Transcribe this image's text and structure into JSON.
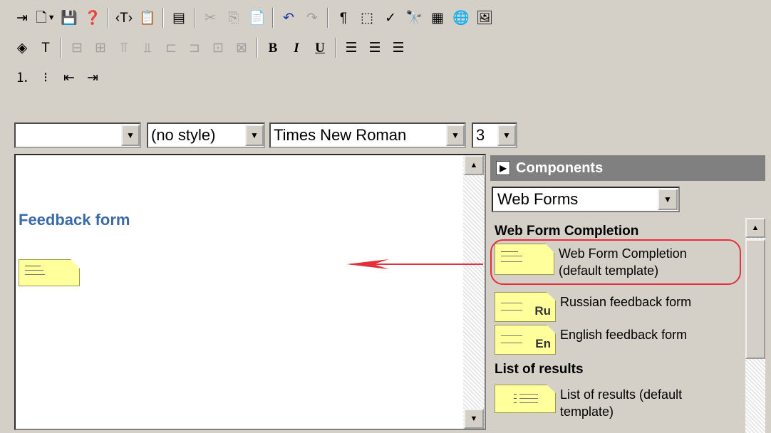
{
  "toolbar": {
    "row1": [
      {
        "name": "exit-icon",
        "glyph": "⇥"
      },
      {
        "name": "new-document-icon",
        "glyph": "🗋",
        "dropdown": true
      },
      {
        "name": "save-icon",
        "glyph": "💾"
      },
      {
        "name": "help-icon",
        "glyph": "❓"
      },
      {
        "sep": true
      },
      {
        "name": "insert-tag-icon",
        "glyph": "‹T›"
      },
      {
        "name": "properties-icon",
        "glyph": "📋"
      },
      {
        "sep": true
      },
      {
        "name": "source-view-icon",
        "glyph": "▤"
      },
      {
        "sep": true
      },
      {
        "name": "cut-icon",
        "glyph": "✂",
        "disabled": true
      },
      {
        "name": "copy-icon",
        "glyph": "⎘",
        "disabled": true
      },
      {
        "name": "paste-icon",
        "glyph": "📄",
        "disabled": true
      },
      {
        "sep": true
      },
      {
        "name": "undo-icon",
        "glyph": "↶",
        "blue": true
      },
      {
        "name": "redo-icon",
        "glyph": "↷",
        "disabled": true
      },
      {
        "sep": true
      },
      {
        "name": "paragraph-marks-icon",
        "glyph": "¶"
      },
      {
        "name": "show-borders-icon",
        "glyph": "⬚"
      },
      {
        "name": "spell-check-icon",
        "glyph": "✓"
      },
      {
        "name": "find-icon",
        "glyph": "🔭"
      },
      {
        "name": "insert-table-icon",
        "glyph": "▦"
      },
      {
        "name": "web-link-icon",
        "glyph": "🌐",
        "disabled": true
      },
      {
        "name": "insert-image-icon",
        "glyph": "🖼"
      }
    ],
    "row2": [
      {
        "name": "background-color-icon",
        "glyph": "◈"
      },
      {
        "name": "text-color-icon",
        "glyph": "T"
      },
      {
        "sep": true
      },
      {
        "name": "insert-row-before-icon",
        "glyph": "⊟",
        "disabled": true
      },
      {
        "name": "insert-row-after-icon",
        "glyph": "⊞",
        "disabled": true
      },
      {
        "name": "insert-column-before-icon",
        "glyph": "⫪",
        "disabled": true
      },
      {
        "name": "insert-column-after-icon",
        "glyph": "⫫",
        "disabled": true
      },
      {
        "name": "delete-row-icon",
        "glyph": "⊏",
        "disabled": true
      },
      {
        "name": "delete-column-icon",
        "glyph": "⊐",
        "disabled": true
      },
      {
        "name": "merge-cells-icon",
        "glyph": "⊡",
        "disabled": true
      },
      {
        "name": "split-cell-icon",
        "glyph": "⊠",
        "disabled": true
      },
      {
        "sep": true
      },
      {
        "name": "bold-icon",
        "glyph": "B",
        "style": "bold"
      },
      {
        "name": "italic-icon",
        "glyph": "I",
        "style": "italic"
      },
      {
        "name": "underline-icon",
        "glyph": "U",
        "style": "under"
      },
      {
        "sep": true
      },
      {
        "name": "align-left-icon",
        "glyph": "☰"
      },
      {
        "name": "align-center-icon",
        "glyph": "☰"
      },
      {
        "name": "align-right-icon",
        "glyph": "☰"
      }
    ],
    "row3": [
      {
        "name": "numbered-list-icon",
        "glyph": "⒈"
      },
      {
        "name": "bulleted-list-icon",
        "glyph": "⁝"
      },
      {
        "name": "outdent-icon",
        "glyph": "⇤"
      },
      {
        "name": "indent-icon",
        "glyph": "⇥"
      }
    ]
  },
  "format_bar": {
    "block_value": "",
    "style_value": "(no style)",
    "font_value": "Times New Roman",
    "size_value": "3"
  },
  "editor": {
    "heading": "Feedback form"
  },
  "panel": {
    "title": "Components",
    "category": "Web Forms",
    "groups": [
      {
        "heading": "Web Form Completion",
        "items": [
          {
            "label_line1": "Web Form Completion",
            "label_line2": "(default template)",
            "code": ""
          },
          {
            "label_line1": "Russian feedback form",
            "label_line2": "",
            "code": "Ru"
          },
          {
            "label_line1": "English feedback form",
            "label_line2": "",
            "code": "En"
          }
        ]
      },
      {
        "heading": "List of results",
        "items": [
          {
            "label_line1": "List of results (default",
            "label_line2": "template)",
            "code": ""
          }
        ]
      }
    ]
  },
  "colors": {
    "heading_blue": "#3b6aa9",
    "component_yellow": "#ffff9c",
    "highlight_red": "#e3303a",
    "arrow_red": "#e3303a",
    "panel_header_gray": "#808080"
  }
}
